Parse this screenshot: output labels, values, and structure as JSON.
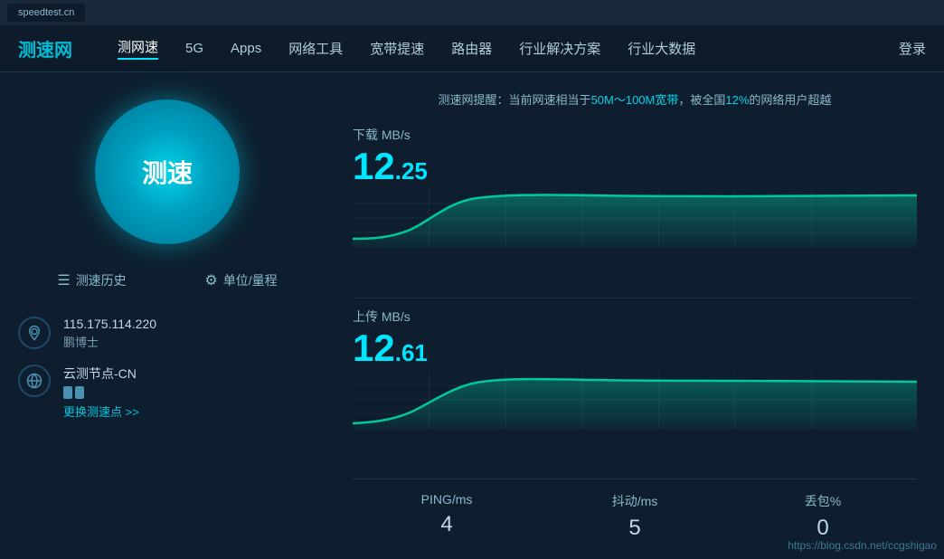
{
  "tabBar": {
    "tabLabel": "speedtest.cn"
  },
  "navbar": {
    "logo": "测速网",
    "items": [
      {
        "label": "测网速",
        "active": true
      },
      {
        "label": "5G",
        "active": false
      },
      {
        "label": "Apps",
        "active": false
      },
      {
        "label": "网络工具",
        "active": false
      },
      {
        "label": "宽带提速",
        "active": false
      },
      {
        "label": "路由器",
        "active": false
      },
      {
        "label": "行业解决方案",
        "active": false
      },
      {
        "label": "行业大数据",
        "active": false
      }
    ],
    "login": "登录"
  },
  "notice": {
    "prefix": "测速网提醒：当前网速相当于",
    "bandwidth": "50M～100M宽带",
    "middle": "，被全国",
    "percent": "12%",
    "suffix": "的网络用户超越"
  },
  "speedButton": {
    "label": "测速"
  },
  "controls": {
    "history": "测速历史",
    "settings": "单位/量程"
  },
  "ipInfo": {
    "ip": "115.175.114.220",
    "location": "鹏博士"
  },
  "serverInfo": {
    "label": "云测节点-CN",
    "changeText": "更换测速点 >>"
  },
  "download": {
    "label": "下载 MB/s",
    "intPart": "12",
    "decPart": ".25"
  },
  "upload": {
    "label": "上传 MB/s",
    "intPart": "12",
    "decPart": ".61"
  },
  "stats": {
    "ping": {
      "label": "PING/ms",
      "value": "4"
    },
    "jitter": {
      "label": "抖动/ms",
      "value": "5"
    },
    "loss": {
      "label": "丢包%",
      "value": "0"
    }
  },
  "watermark": "https://blog.csdn.net/ccgshigao",
  "colors": {
    "accent": "#00e5ff",
    "chartStroke": "#00c8a0",
    "background": "#0d1b2a",
    "navBg": "#0d1b2a"
  }
}
